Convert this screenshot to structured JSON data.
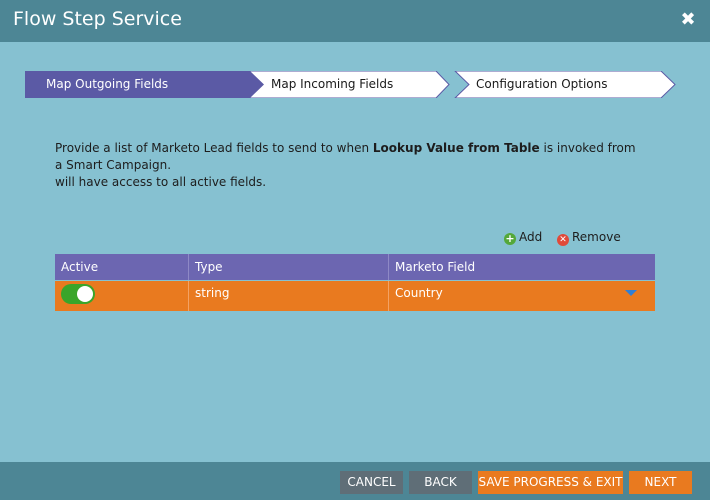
{
  "dialog": {
    "title": "Flow Step Service",
    "close_icon": "close-icon"
  },
  "steps": [
    {
      "label": "Map Outgoing Fields",
      "active": true
    },
    {
      "label": "Map Incoming Fields",
      "active": false
    },
    {
      "label": "Configuration Options",
      "active": false
    }
  ],
  "description": {
    "line1_prefix": "Provide a list of Marketo Lead fields to send to when ",
    "line1_bold": "Lookup Value from Table",
    "line1_suffix": " is invoked from a Smart Campaign.",
    "line2": "will have access to all active fields."
  },
  "actions": {
    "add_label": "Add",
    "remove_label": "Remove"
  },
  "table": {
    "headers": [
      "Active",
      "Type",
      "Marketo Field"
    ],
    "rows": [
      {
        "active": true,
        "type": "string",
        "marketo_field": "Country"
      }
    ]
  },
  "footer": {
    "cancel": "CANCEL",
    "back": "BACK",
    "save_exit": "SAVE PROGRESS & EXIT",
    "next": "NEXT"
  },
  "colors": {
    "header_bar": "#4d8695",
    "background": "#86c1d1",
    "step_active": "#5b5aa5",
    "table_header": "#6c66b1",
    "row_selected": "#e97a1f",
    "toggle_on": "#3aa52a",
    "button_grey": "#5f6e77",
    "button_orange": "#e97a1f"
  }
}
